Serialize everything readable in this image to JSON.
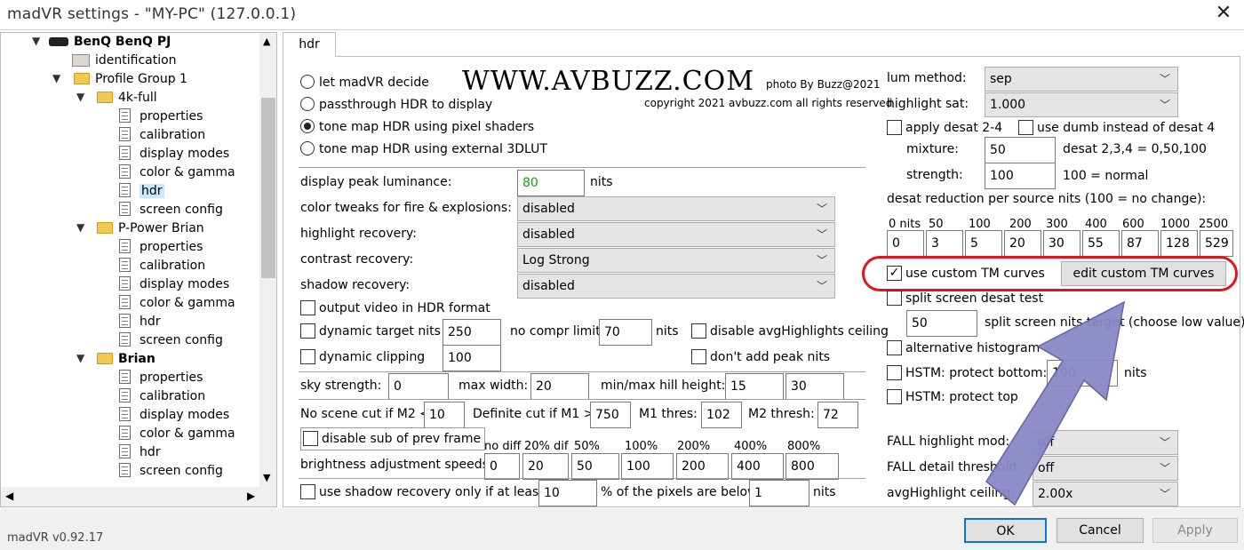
{
  "window": {
    "title": "madVR settings - \"MY-PC\" (127.0.0.1)",
    "close_glyph": "✕"
  },
  "tree": {
    "device": "BenQ BenQ PJ",
    "identification": "identification",
    "profile_group": "Profile Group 1",
    "profiles": [
      {
        "name": "4k-full",
        "items": [
          "properties",
          "calibration",
          "display modes",
          "color & gamma",
          "hdr",
          "screen config"
        ]
      },
      {
        "name": "P-Power Brian",
        "items": [
          "properties",
          "calibration",
          "display modes",
          "color & gamma",
          "hdr",
          "screen config"
        ]
      },
      {
        "name": "Brian",
        "items": [
          "properties",
          "calibration",
          "display modes",
          "color & gamma",
          "hdr",
          "screen config"
        ]
      }
    ]
  },
  "tab": {
    "label": "hdr"
  },
  "watermark": {
    "brand": "WWW.AVBUZZ.COM",
    "photo": "photo By Buzz@2021",
    "copyright": "copyright 2021 avbuzz.com all rights reserved"
  },
  "modes": [
    "let madVR decide",
    "passthrough HDR to display",
    "tone map HDR using pixel shaders",
    "tone map HDR using external 3DLUT"
  ],
  "peak": {
    "label": "display peak luminance:",
    "value": "80",
    "unit": "nits"
  },
  "dropdowns": [
    {
      "label": "color tweaks for fire & explosions:",
      "value": "disabled"
    },
    {
      "label": "highlight recovery:",
      "value": "disabled"
    },
    {
      "label": "contrast recovery:",
      "value": "Log Strong"
    },
    {
      "label": "shadow recovery:",
      "value": "disabled"
    }
  ],
  "output_hdr": "output video in HDR format",
  "dyn_target": {
    "label": "dynamic target nits",
    "value": "250",
    "nocompr_label": "no compr limit:",
    "nocompr_value": "70",
    "unit": "nits",
    "disable_avg": "disable avgHighlights ceiling"
  },
  "dyn_clip": {
    "label": "dynamic clipping",
    "value": "100",
    "dont_add": "don't add peak nits"
  },
  "sky": {
    "label": "sky strength:",
    "value": "0",
    "max_width_label": "max width:",
    "max_width": "20",
    "hill_label": "min/max hill height:",
    "hill_min": "15",
    "hill_max": "30"
  },
  "scene": {
    "label": "No scene cut if M2 <",
    "value": "10",
    "def_label": "Definite cut if M1 >",
    "def_value": "750",
    "m1_label": "M1 thres:",
    "m1_value": "102",
    "m2_label": "M2 thresh:",
    "m2_value": "72"
  },
  "disable_sub": "disable sub of prev frame",
  "speeds": {
    "label": "brightness adjustment speeds:",
    "headers": [
      "no diff",
      "20% dif",
      "50%",
      "100%",
      "200%",
      "400%",
      "800%"
    ],
    "values": [
      "0",
      "20",
      "50",
      "100",
      "200",
      "400",
      "800"
    ]
  },
  "shadow_only": {
    "label": "use shadow recovery only if at least:",
    "value": "10",
    "mid": "% of the pixels are below",
    "value2": "1",
    "unit": "nits"
  },
  "right": {
    "lum_label": "lum method:",
    "lum_value": "sep",
    "hsat_label": "highlight sat:",
    "hsat_value": "1.000",
    "desat24": "apply desat 2-4",
    "dumb": "use dumb instead of desat 4",
    "mixture_label": "mixture:",
    "mixture_value": "50",
    "mixture_note": "desat 2,3,4 = 0,50,100",
    "strength_label": "strength:",
    "strength_value": "100",
    "strength_note": "100 = normal",
    "desat_red_label": "desat reduction per source nits (100 = no change):",
    "nits_headers": [
      "0 nits",
      "50",
      "100",
      "200",
      "300",
      "400",
      "600",
      "1000",
      "2500"
    ],
    "nits_values": [
      "0",
      "3",
      "5",
      "20",
      "30",
      "55",
      "87",
      "128",
      "529"
    ],
    "custom_tm": "use custom TM curves",
    "edit_tm": "edit custom TM curves",
    "split": "split screen desat test",
    "split_value": "50",
    "split_note": "split screen nits target (choose low value)",
    "alt_hist": "alternative histogram",
    "hstm_bottom": "HSTM: protect bottom:",
    "hstm_value": "100",
    "hstm_unit": "nits",
    "hstm_top": "HSTM: protect top",
    "fall_mod_label": "FALL highlight mod:",
    "fall_mod_value": "off",
    "fall_detail_label": "FALL detail threshold:",
    "fall_detail_value": "off",
    "avg_label": "avgHighlight ceiling:",
    "avg_value": "2.00x"
  },
  "footer": {
    "version": "madVR v0.92.17",
    "ok": "OK",
    "cancel": "Cancel",
    "apply": "Apply"
  },
  "colors": {
    "arrow": "#8a88c6",
    "ring": "#e0141e",
    "peak_value": "#1f9d1f"
  },
  "icons": [
    "projector-icon",
    "folder-icon",
    "page-icon",
    "chevron-down-icon",
    "arrow-pointer-icon"
  ]
}
